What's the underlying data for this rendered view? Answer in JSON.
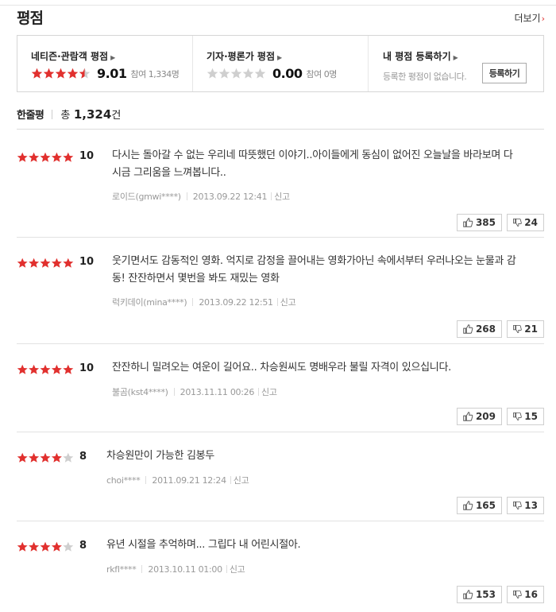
{
  "header": {
    "title": "평점",
    "more_label": "더보기",
    "more_arrow": "›"
  },
  "ratings": {
    "netizen": {
      "title": "네티즌·관람객 평점",
      "stars": 4.5,
      "score": "9.01",
      "participants": "참여 1,334명"
    },
    "critic": {
      "title": "기자·평론가 평점",
      "stars": 0,
      "score": "0.00",
      "participants": "참여 0명"
    },
    "mine": {
      "title": "내 평점 등록하기",
      "message": "등록한 평점이 없습니다.",
      "button": "등록하기"
    }
  },
  "summary": {
    "title": "한줄평",
    "total_label": "총",
    "total_count": "1,324",
    "unit": "건"
  },
  "reviews": [
    {
      "stars": 5,
      "score": "10",
      "text": "다시는 돌아갈 수 없는 우리네 따뜻했던 이야기..아이들에게 동심이 없어진 오늘날을 바라보며 다시금 그리움을 느껴봅니다..",
      "user": "로이드(gmwi****)",
      "date": "2013.09.22 12:41",
      "report": "신고",
      "up": "385",
      "down": "24"
    },
    {
      "stars": 5,
      "score": "10",
      "text": "웃기면서도 감동적인 영화. 억지로 감정을 끌어내는 영화가아닌 속에서부터 우러나오는 눈물과 감동! 잔잔하면서 몇번을 봐도 재밌는 영화",
      "user": "럭키데이(mina****)",
      "date": "2013.09.22 12:51",
      "report": "신고",
      "up": "268",
      "down": "21"
    },
    {
      "stars": 5,
      "score": "10",
      "text": "잔잔하니 밀려오는 여운이 길어요.. 차승원씨도 명배우라 불릴 자격이 있으십니다.",
      "user": "불곰(kst4****)",
      "date": "2013.11.11 00:26",
      "report": "신고",
      "up": "209",
      "down": "15"
    },
    {
      "stars": 4,
      "score": "8",
      "text": "차승원만이 가능한 김봉두",
      "user": "choi****",
      "date": "2011.09.21 12:24",
      "report": "신고",
      "up": "165",
      "down": "13"
    },
    {
      "stars": 4,
      "score": "8",
      "text": "유년 시절을 추억하며... 그립다 내 어린시절아.",
      "user": "rkfl****",
      "date": "2013.10.11 01:00",
      "report": "신고",
      "up": "153",
      "down": "16"
    }
  ],
  "colors": {
    "star_on": "#e1302e",
    "star_off": "#cfcfcf",
    "accent": "#e1302e"
  }
}
